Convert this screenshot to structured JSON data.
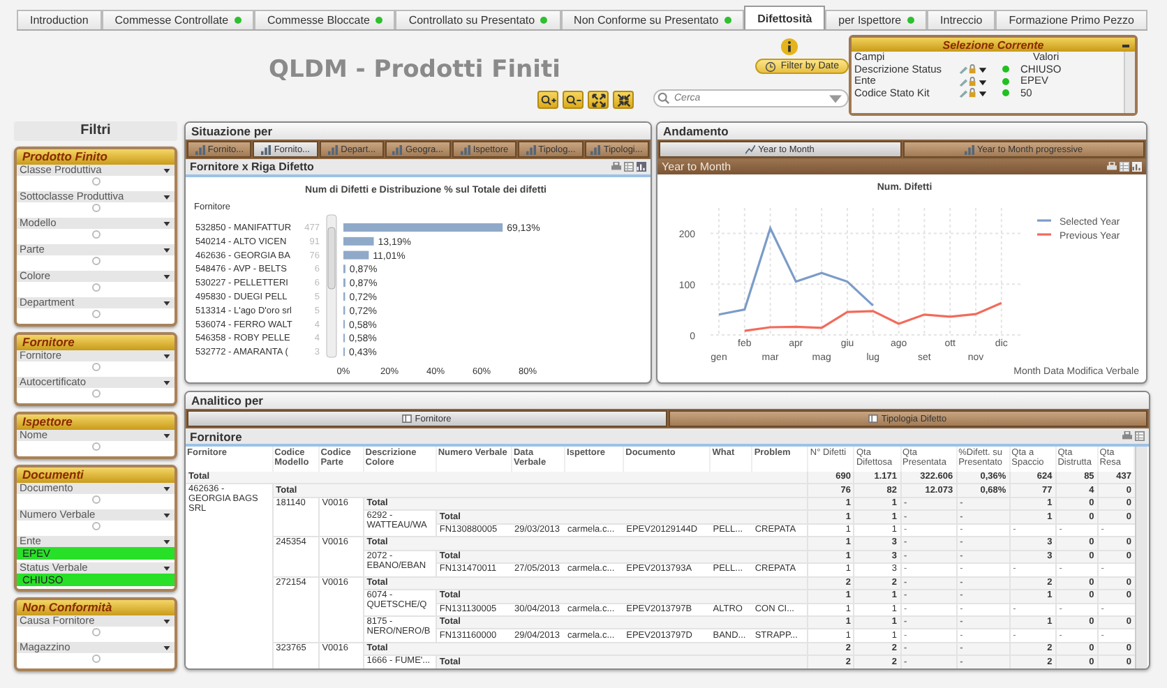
{
  "tabs": [
    {
      "label": "Introduction",
      "indicator": false,
      "selected": false
    },
    {
      "label": "Commesse Controllate",
      "indicator": true,
      "selected": false
    },
    {
      "label": "Commesse Bloccate",
      "indicator": true,
      "selected": false
    },
    {
      "label": "Controllato su Presentato",
      "indicator": true,
      "selected": false
    },
    {
      "label": "Non Conforme su Presentato",
      "indicator": true,
      "selected": false
    },
    {
      "label": "Difettosità",
      "indicator": false,
      "selected": true
    },
    {
      "label": "per Ispettore",
      "indicator": true,
      "selected": false
    },
    {
      "label": "Intreccio",
      "indicator": false,
      "selected": false
    },
    {
      "label": "Formazione Primo Pezzo",
      "indicator": false,
      "selected": false
    }
  ],
  "header": {
    "title": "QLDM - Prodotti Finiti",
    "filter_button": "Filter by Date",
    "search": {
      "placeholder": "Cerca"
    }
  },
  "current_selections": {
    "title": "Selezione Corrente",
    "columns": [
      "Campi",
      "Valori"
    ],
    "rows": [
      {
        "field": "Descrizione Status",
        "value": "CHIUSO"
      },
      {
        "field": "Ente",
        "value": "EPEV"
      },
      {
        "field": "Codice Stato Kit",
        "value": "50"
      }
    ]
  },
  "filters": {
    "title": "Filtri",
    "groups": [
      {
        "title": "Prodotto Finito",
        "fields": [
          {
            "label": "Classe Produttiva"
          },
          {
            "label": "Sottoclasse Produttiva"
          },
          {
            "label": "Modello"
          },
          {
            "label": "Parte"
          },
          {
            "label": "Colore"
          },
          {
            "label": "Department"
          }
        ]
      },
      {
        "title": "Fornitore",
        "fields": [
          {
            "label": "Fornitore"
          },
          {
            "label": "Autocertificato"
          }
        ]
      },
      {
        "title": "Ispettore",
        "fields": [
          {
            "label": "Nome"
          }
        ]
      },
      {
        "title": "Documenti",
        "fields": [
          {
            "label": "Documento"
          },
          {
            "label": "Numero Verbale"
          },
          {
            "label": "Ente",
            "value": "EPEV"
          },
          {
            "label": "Status Verbale",
            "value": "CHIUSO"
          }
        ]
      },
      {
        "title": "Non Conformità",
        "fields": [
          {
            "label": "Causa Fornitore"
          },
          {
            "label": "Magazzino"
          }
        ]
      }
    ]
  },
  "situazione": {
    "title": "Situazione per",
    "buttons": [
      {
        "label": "Fornito...",
        "kind": "bar",
        "selected": false
      },
      {
        "label": "Fornito...",
        "kind": "bar",
        "selected": true
      },
      {
        "label": "Depart...",
        "kind": "bar",
        "selected": false
      },
      {
        "label": "Geogra...",
        "kind": "bar",
        "selected": false
      },
      {
        "label": "Ispettore",
        "kind": "bar",
        "selected": false
      },
      {
        "label": "Tipolog...",
        "kind": "bar",
        "selected": false
      },
      {
        "label": "Tipologi...",
        "kind": "bar",
        "selected": false
      }
    ],
    "caption": "Fornitore x Riga Difetto",
    "chart_data": {
      "type": "bar",
      "orientation": "horizontal",
      "title": "Num di Difetti e Distribuzione % sul Totale dei difetti",
      "ylabel": "Fornitore",
      "categories": [
        "532850 - MANIFATTUR",
        "540214 - ALTO VICEN",
        "462636 - GEORGIA BA",
        "548476 - AVP - BELTS",
        "530227 - PELLETTERI",
        "495830 - DUEGI PELL",
        "513314 - L'ago D'oro srl",
        "536074 - FERRO WALT",
        "546358 - ROBY PELLE",
        "532772 - AMARANTA ("
      ],
      "values": [
        69.13,
        13.19,
        11.01,
        0.87,
        0.87,
        0.72,
        0.72,
        0.58,
        0.58,
        0.43
      ],
      "value_labels": [
        "69,13%",
        "13,19%",
        "11,01%",
        "0,87%",
        "0,87%",
        "0,72%",
        "0,72%",
        "0,58%",
        "0,58%",
        "0,43%"
      ],
      "annotations": [
        "477",
        "91",
        "76",
        "6",
        "6",
        "5",
        "5",
        "4",
        "4",
        "3"
      ],
      "xlim": [
        0,
        80
      ],
      "xticks": [
        {
          "value": 0,
          "label": "0%"
        },
        {
          "value": 20,
          "label": "20%"
        },
        {
          "value": 40,
          "label": "40%"
        },
        {
          "value": 60,
          "label": "60%"
        },
        {
          "value": 80,
          "label": "80%"
        }
      ]
    }
  },
  "andamento": {
    "title": "Andamento",
    "buttons": [
      {
        "label": "Year to Month",
        "kind": "line",
        "selected": true
      },
      {
        "label": "Year to Month progressive",
        "kind": "bar",
        "selected": false
      }
    ],
    "caption": "Year to Month",
    "chart_data": {
      "type": "line",
      "title": "Num. Difetti",
      "xlabel": "Month Data Modifica Verbale",
      "categories": [
        "gen",
        "feb",
        "mar",
        "apr",
        "mag",
        "giu",
        "lug",
        "ago",
        "set",
        "ott",
        "nov",
        "dic"
      ],
      "series": [
        {
          "name": "Selected Year",
          "color": "#7b9cc8",
          "values": [
            40,
            50,
            210,
            105,
            122,
            105,
            58,
            null,
            null,
            null,
            null,
            null
          ]
        },
        {
          "name": "Previous Year",
          "color": "#f26b5b",
          "values": [
            null,
            8,
            15,
            16,
            14,
            45,
            47,
            22,
            40,
            36,
            41,
            63
          ]
        }
      ],
      "ylim": [
        0,
        250
      ],
      "yticks": [
        0,
        100,
        200
      ],
      "grid": true,
      "legend": true
    }
  },
  "analitico": {
    "title": "Analitico per",
    "buttons": [
      {
        "label": "Fornitore",
        "kind": "table",
        "selected": true
      },
      {
        "label": "Tipologia Difetto",
        "kind": "table",
        "selected": false
      }
    ],
    "caption": "Fornitore",
    "table": {
      "columns": [
        "Fornitore",
        "Codice Modello",
        "Codice Parte",
        "Descrizione Colore",
        "Numero Verbale",
        "Data Verbale",
        "Ispettore",
        "Documento",
        "What",
        "Problem",
        "N° Difetti",
        "Qta Difettosa",
        "Qta Presentata",
        "%Difett. su Presentato",
        "Qta a Spaccio",
        "Qta Distrutta",
        "Qta Resa"
      ],
      "rows": [
        {
          "kind": "total",
          "fornitore": "Total",
          "values": [
            "690",
            "1.171",
            "322.606",
            "0,36%",
            "624",
            "85",
            "437"
          ]
        },
        {
          "kind": "total",
          "fornitore": "462636 - GEORGIA BAGS SRL",
          "codice_modello": "Total",
          "values": [
            "76",
            "82",
            "12.073",
            "0,68%",
            "77",
            "4",
            "0"
          ]
        },
        {
          "kind": "total",
          "codice_modello": "181140",
          "codice_parte": "V0016",
          "descrizione_colore": "Total",
          "values": [
            "1",
            "1",
            "-",
            "-",
            "1",
            "0",
            "0"
          ]
        },
        {
          "kind": "total",
          "descrizione_colore": "6292 - WATTEAU/WA",
          "numero_verbale": "Total",
          "values": [
            "1",
            "1",
            "-",
            "-",
            "1",
            "0",
            "0"
          ]
        },
        {
          "kind": "detail",
          "numero_verbale": "FN130880005",
          "data_verbale": "29/03/2013",
          "ispettore": "carmela.c...",
          "documento": "EPEV20129144D",
          "what": "PELL...",
          "problem": "CREPATA",
          "values": [
            "1",
            "1",
            "-",
            "-",
            "-",
            "-",
            "-"
          ]
        },
        {
          "kind": "total",
          "codice_modello": "245354",
          "codice_parte": "V0016",
          "descrizione_colore": "Total",
          "values": [
            "1",
            "3",
            "-",
            "-",
            "3",
            "0",
            "0"
          ]
        },
        {
          "kind": "total",
          "descrizione_colore": "2072 - EBANO/EBAN",
          "numero_verbale": "Total",
          "values": [
            "1",
            "3",
            "-",
            "-",
            "3",
            "0",
            "0"
          ]
        },
        {
          "kind": "detail",
          "numero_verbale": "FN131470011",
          "data_verbale": "27/05/2013",
          "ispettore": "carmela.c...",
          "documento": "EPEV2013793A",
          "what": "PELL...",
          "problem": "CREPATA",
          "values": [
            "1",
            "3",
            "-",
            "-",
            "-",
            "-",
            "-"
          ]
        },
        {
          "kind": "total",
          "codice_modello": "272154",
          "codice_parte": "V0016",
          "descrizione_colore": "Total",
          "values": [
            "2",
            "2",
            "-",
            "-",
            "2",
            "0",
            "0"
          ]
        },
        {
          "kind": "total",
          "descrizione_colore": "6074 - QUETSCHE/Q",
          "numero_verbale": "Total",
          "values": [
            "1",
            "1",
            "-",
            "-",
            "1",
            "0",
            "0"
          ]
        },
        {
          "kind": "detail",
          "numero_verbale": "FN131130005",
          "data_verbale": "30/04/2013",
          "ispettore": "carmela.c...",
          "documento": "EPEV2013797B",
          "what": "ALTRO",
          "problem": "CON CI...",
          "values": [
            "1",
            "1",
            "-",
            "-",
            "-",
            "-",
            "-"
          ]
        },
        {
          "kind": "total",
          "descrizione_colore": "8175 - NERO/NERO/B",
          "numero_verbale": "Total",
          "values": [
            "1",
            "1",
            "-",
            "-",
            "1",
            "0",
            "0"
          ]
        },
        {
          "kind": "detail",
          "numero_verbale": "FN131160000",
          "data_verbale": "29/04/2013",
          "ispettore": "carmela.c...",
          "documento": "EPEV2013797D",
          "what": "BAND...",
          "problem": "STRAPP...",
          "values": [
            "1",
            "1",
            "-",
            "-",
            "-",
            "-",
            "-"
          ]
        },
        {
          "kind": "total",
          "codice_modello": "323765",
          "codice_parte": "V0016",
          "descrizione_colore": "Total",
          "values": [
            "2",
            "2",
            "-",
            "-",
            "2",
            "0",
            "0"
          ]
        },
        {
          "kind": "total",
          "descrizione_colore": "1666 - FUME'...",
          "numero_verbale": "Total",
          "values": [
            "2",
            "2",
            "-",
            "-",
            "2",
            "0",
            "0"
          ]
        }
      ]
    }
  }
}
